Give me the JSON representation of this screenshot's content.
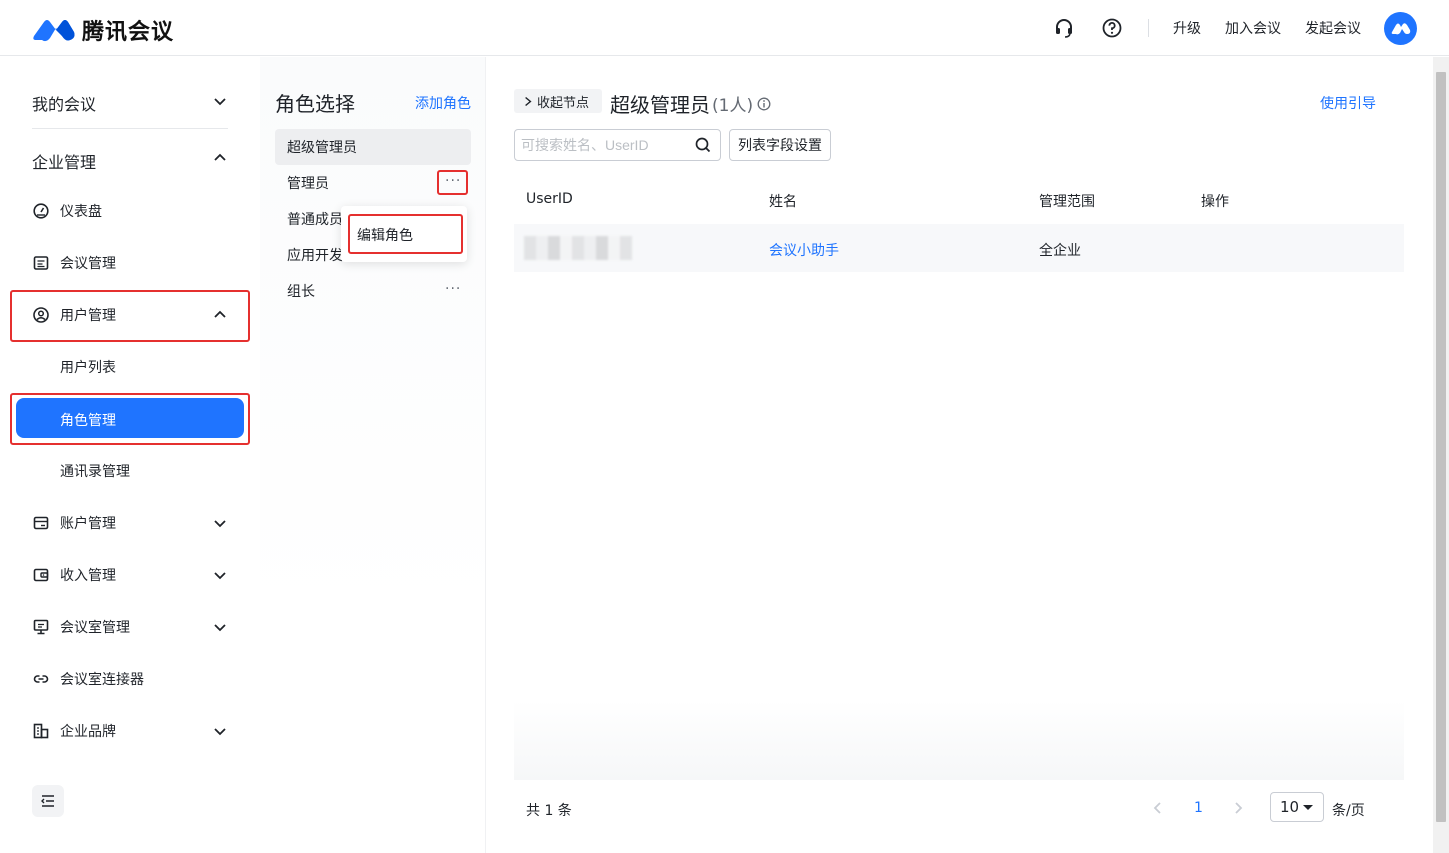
{
  "header": {
    "app_name": "腾讯会议",
    "upgrade": "升级",
    "join_meeting": "加入会议",
    "start_meeting": "发起会议",
    "brand_color": "#1f74ff"
  },
  "sidebar": {
    "my_meetings": "我的会议",
    "enterprise_mgmt": "企业管理",
    "items": [
      {
        "label": "仪表盘",
        "icon": "dashboard-icon"
      },
      {
        "label": "会议管理",
        "icon": "meeting-list-icon"
      },
      {
        "label": "用户管理",
        "icon": "user-circle-icon"
      },
      {
        "label": "账户管理",
        "icon": "wallet-icon"
      },
      {
        "label": "收入管理",
        "icon": "income-icon"
      },
      {
        "label": "会议室管理",
        "icon": "meeting-room-icon"
      },
      {
        "label": "会议室连接器",
        "icon": "link-icon"
      },
      {
        "label": "企业品牌",
        "icon": "brand-icon"
      }
    ],
    "user_sub": {
      "user_list": "用户列表",
      "role_mgmt": "角色管理",
      "contacts_mgmt": "通讯录管理"
    }
  },
  "roles": {
    "title": "角色选择",
    "add": "添加角色",
    "list": [
      "超级管理员",
      "管理员",
      "普通成员",
      "应用开发",
      "组长"
    ],
    "more": "···",
    "menu_edit": "编辑角色"
  },
  "main": {
    "collapse_node": "收起节点",
    "title": "超级管理员",
    "count": "(1人)",
    "guide": "使用引导",
    "search_placeholder": "可搜索姓名、UserID",
    "column_settings": "列表字段设置",
    "columns": [
      "UserID",
      "姓名",
      "管理范围",
      "操作"
    ],
    "rows": [
      {
        "name": "会议小助手",
        "scope": "全企业"
      }
    ]
  },
  "pagination": {
    "total": "共 1 条",
    "current": "1",
    "page_size": "10",
    "unit": "条/页"
  }
}
